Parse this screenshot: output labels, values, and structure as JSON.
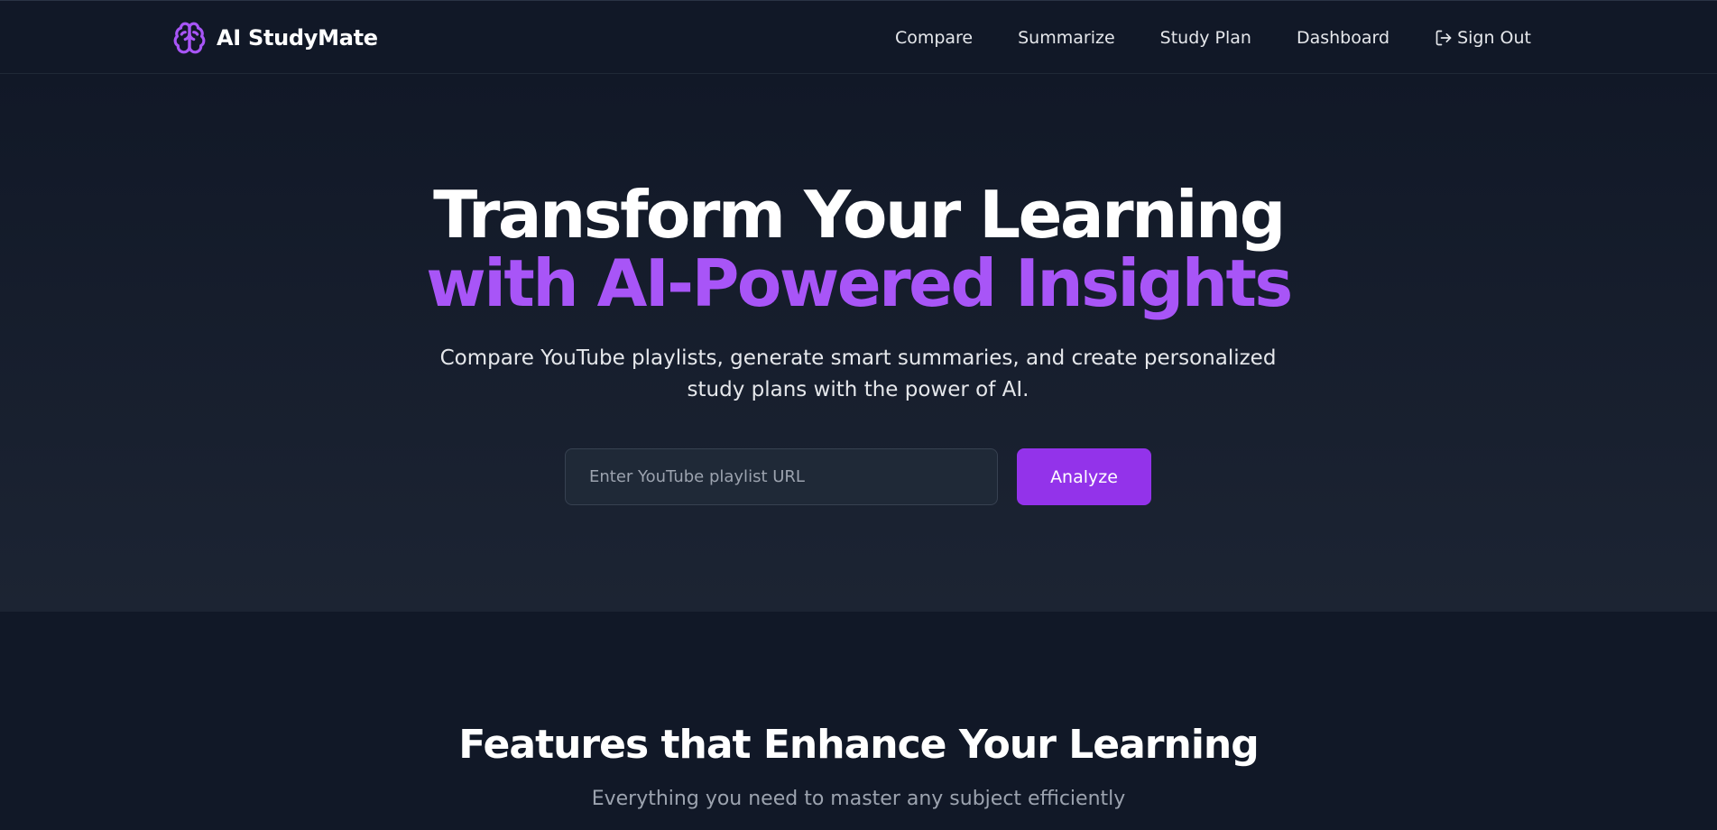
{
  "navbar": {
    "brand": {
      "name": "AI StudyMate",
      "icon": "brain-icon"
    },
    "links": [
      {
        "label": "Compare"
      },
      {
        "label": "Summarize"
      },
      {
        "label": "Study Plan"
      },
      {
        "label": "Dashboard"
      }
    ],
    "signout": {
      "label": "Sign Out",
      "icon": "sign-out-icon"
    }
  },
  "hero": {
    "title_line1": "Transform Your Learning",
    "title_line2": "with AI-Powered Insights",
    "subtitle": "Compare YouTube playlists, generate smart summaries, and create personalized study plans with the power of AI.",
    "input": {
      "value": "",
      "placeholder": "Enter YouTube playlist URL"
    },
    "analyze_label": "Analyze"
  },
  "features": {
    "title": "Features that Enhance Your Learning",
    "subtitle": "Everything you need to master any subject efficiently"
  },
  "colors": {
    "background": "#111827",
    "accent": "#a855f7",
    "button": "#9333ea",
    "text_muted": "#9ca3af"
  }
}
